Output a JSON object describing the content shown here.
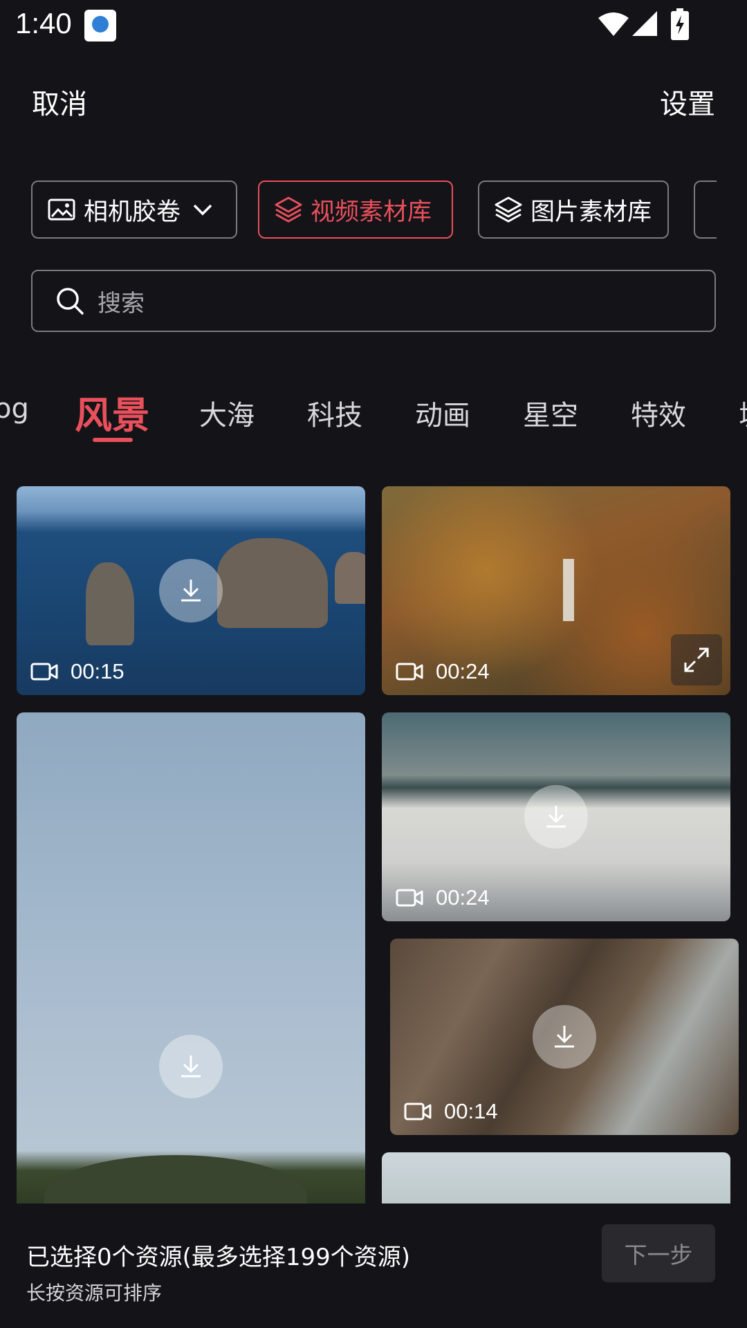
{
  "status_bar": {
    "time": "1:40"
  },
  "header": {
    "cancel_label": "取消",
    "settings_label": "设置"
  },
  "sources": {
    "camera_roll": "相机胶卷",
    "video_library": "视频素材库",
    "image_library": "图片素材库"
  },
  "search": {
    "placeholder": "搜索"
  },
  "categories": {
    "items": [
      "og",
      "风景",
      "大海",
      "科技",
      "动画",
      "星空",
      "特效",
      "城"
    ],
    "active": "风景"
  },
  "media": [
    {
      "duration": "00:15"
    },
    {
      "duration": "00:24"
    },
    {
      "duration": ""
    },
    {
      "duration": "00:24"
    },
    {
      "duration": "00:14"
    }
  ],
  "footer": {
    "selection_text": "已选择0个资源(最多选择199个资源)",
    "hint": "长按资源可排序",
    "next_label": "下一步"
  },
  "colors": {
    "accent": "#e8505b",
    "background": "#141318"
  }
}
